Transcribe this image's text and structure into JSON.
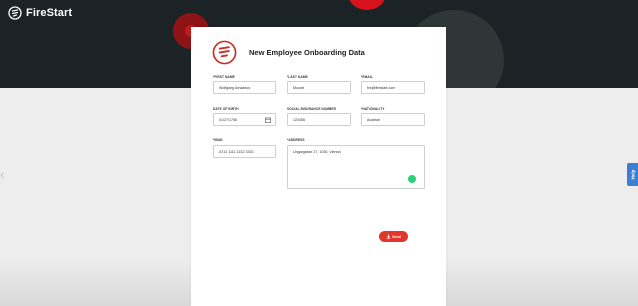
{
  "app": {
    "name": "FireStart"
  },
  "help": {
    "label": "Help"
  },
  "form": {
    "title": "New Employee Onboarding Data",
    "fields": {
      "first_name": {
        "label": "*FIRST NAME",
        "value": "Wolfgang Amadeus"
      },
      "last_name": {
        "label": "*LAST NAME",
        "value": "Mozart"
      },
      "email": {
        "label": "*EMAIL",
        "value": "frw@firestart.com"
      },
      "date_of_birth": {
        "label": "DATE OF BIRTH",
        "value": "01/27/1756"
      },
      "social_insurance_number": {
        "label": "SOCIAL INSURANCE NUMBER",
        "value": "123456"
      },
      "nationality": {
        "label": "*NATIONALITY",
        "value": "Austrian"
      },
      "iban": {
        "label": "*IBAN",
        "value": "AT12 1111 2222 3333"
      },
      "address": {
        "label": "*ADDRESS",
        "value": "Ungargasse 27, 1030, Vienna"
      }
    },
    "send_label": "Send"
  },
  "colors": {
    "header_bg": "#1c2326",
    "brand_red": "#e2362c",
    "help_blue": "#3d7fd4",
    "status_green": "#2fcf7b"
  }
}
